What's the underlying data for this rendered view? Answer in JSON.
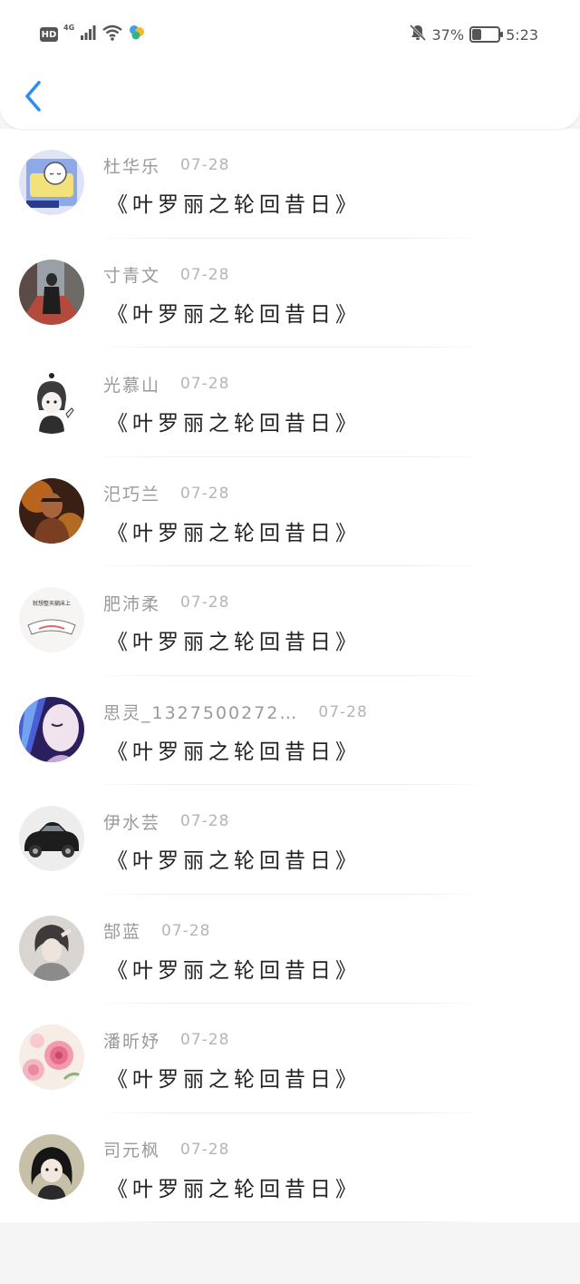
{
  "status_bar": {
    "hd": "HD",
    "network": "4G",
    "battery_percent": "37%",
    "battery_level": 0.37,
    "time": "5:23",
    "icons": [
      "signal-icon",
      "wifi-icon",
      "app-notification-icon",
      "bell-muted-icon",
      "battery-icon"
    ]
  },
  "header": {
    "back_icon": "chevron-left-icon",
    "accent_color": "#2f8cf0"
  },
  "comments": [
    {
      "name": "杜华乐",
      "date": "07-28",
      "message": "《叶罗丽之轮回昔日》",
      "avatar": "cartoon-sleeping-avatar"
    },
    {
      "name": "寸青文",
      "date": "07-28",
      "message": "《叶罗丽之轮回昔日》",
      "avatar": "street-photo-avatar"
    },
    {
      "name": "光慕山",
      "date": "07-28",
      "message": "《叶罗丽之轮回昔日》",
      "avatar": "anime-sketch-avatar"
    },
    {
      "name": "汜巧兰",
      "date": "07-28",
      "message": "《叶罗丽之轮回昔日》",
      "avatar": "game-warrior-avatar"
    },
    {
      "name": "肥沛柔",
      "date": "07-28",
      "message": "《叶罗丽之轮回昔日》",
      "avatar": "meme-bed-avatar"
    },
    {
      "name": "思灵_1327500272…",
      "date": "07-28",
      "message": "《叶罗丽之轮回昔日》",
      "avatar": "purple-face-avatar"
    },
    {
      "name": "伊水芸",
      "date": "07-28",
      "message": "《叶罗丽之轮回昔日》",
      "avatar": "vintage-car-avatar"
    },
    {
      "name": "郜蓝",
      "date": "07-28",
      "message": "《叶罗丽之轮回昔日》",
      "avatar": "portrait-girl-avatar"
    },
    {
      "name": "潘昕妤",
      "date": "07-28",
      "message": "《叶罗丽之轮回昔日》",
      "avatar": "pink-flowers-avatar"
    },
    {
      "name": "司元枫",
      "date": "07-28",
      "message": "《叶罗丽之轮回昔日》",
      "avatar": "dark-hair-girl-avatar"
    }
  ]
}
